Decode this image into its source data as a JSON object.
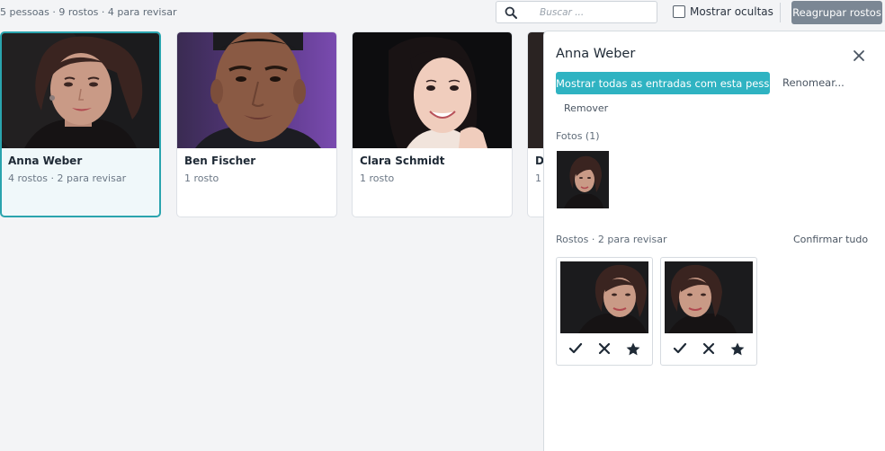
{
  "toolbar": {
    "summary": "5 pessoas · 9 rostos · 4 para revisar",
    "search_placeholder": "Buscar ...",
    "show_hidden_label": "Mostrar ocultas",
    "regroup_label": "Reagrupar rostos",
    "show_hidden_checked": false
  },
  "people": [
    {
      "name": "Anna Weber",
      "meta": "4 rostos · 2 para revisar",
      "selected": true
    },
    {
      "name": "Ben Fischer",
      "meta": "1 rosto",
      "selected": false
    },
    {
      "name": "Clara Schmidt",
      "meta": "1 rosto",
      "selected": false
    },
    {
      "name": "D",
      "meta": "1",
      "selected": false
    }
  ],
  "panel": {
    "title": "Anna Weber",
    "show_entries_label": "Mostrar todas as entradas com esta pessoa",
    "rename_label": "Renomear...",
    "remove_label": "Remover",
    "photos_label": "Fotos (1)",
    "faces_label": "Rostos · 2 para revisar",
    "confirm_all_label": "Confirmar tudo",
    "face_actions": [
      "check-icon",
      "reject-icon",
      "star-icon"
    ]
  },
  "colors": {
    "accent": "#2fb3c2",
    "selected_border": "#2aa4ae",
    "regroup_button": "#7b8794",
    "background": "#f3f4f6"
  }
}
